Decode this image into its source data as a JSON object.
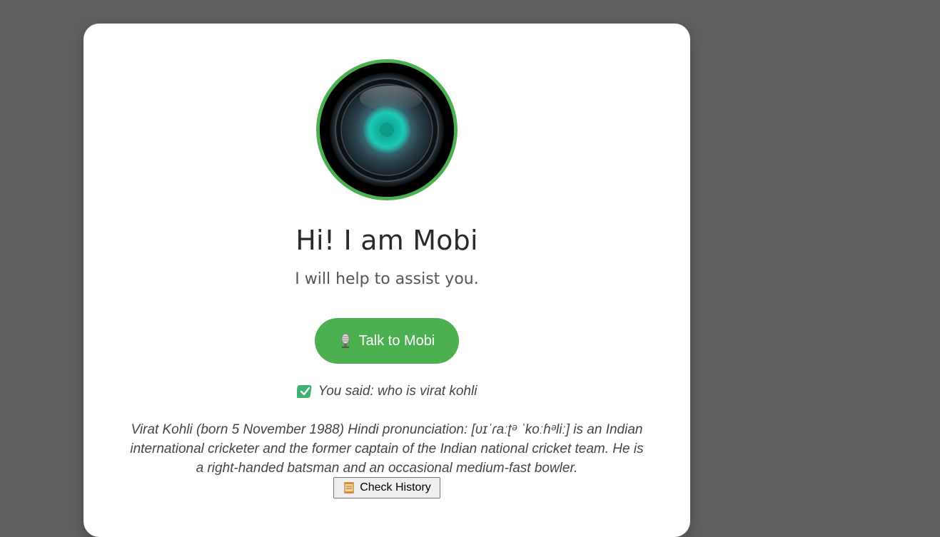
{
  "assistant": {
    "title": "Hi! I am Mobi",
    "subtitle": "I will help to assist you.",
    "avatar_icon": "camera-lens-orb-icon"
  },
  "talk_button": {
    "label": "Talk to Mobi",
    "icon": "microphone-icon"
  },
  "transcript": {
    "icon": "check-mark-button-icon",
    "text": "You said: who is virat kohli"
  },
  "answer": {
    "text": "Virat Kohli (born 5 November 1988) Hindi pronunciation: [ʋɪˈɾaːʈᵊ ˈkoːɦᵊliː]  is an Indian international cricketer and the former captain of the Indian national cricket team. He is a right-handed batsman and an occasional medium-fast bowler."
  },
  "history_button": {
    "label": "Check History",
    "icon": "scroll-icon"
  },
  "colors": {
    "background": "#5f6062",
    "card": "#ffffff",
    "accent": "#4caf50",
    "orb": "#1fb5a6"
  }
}
